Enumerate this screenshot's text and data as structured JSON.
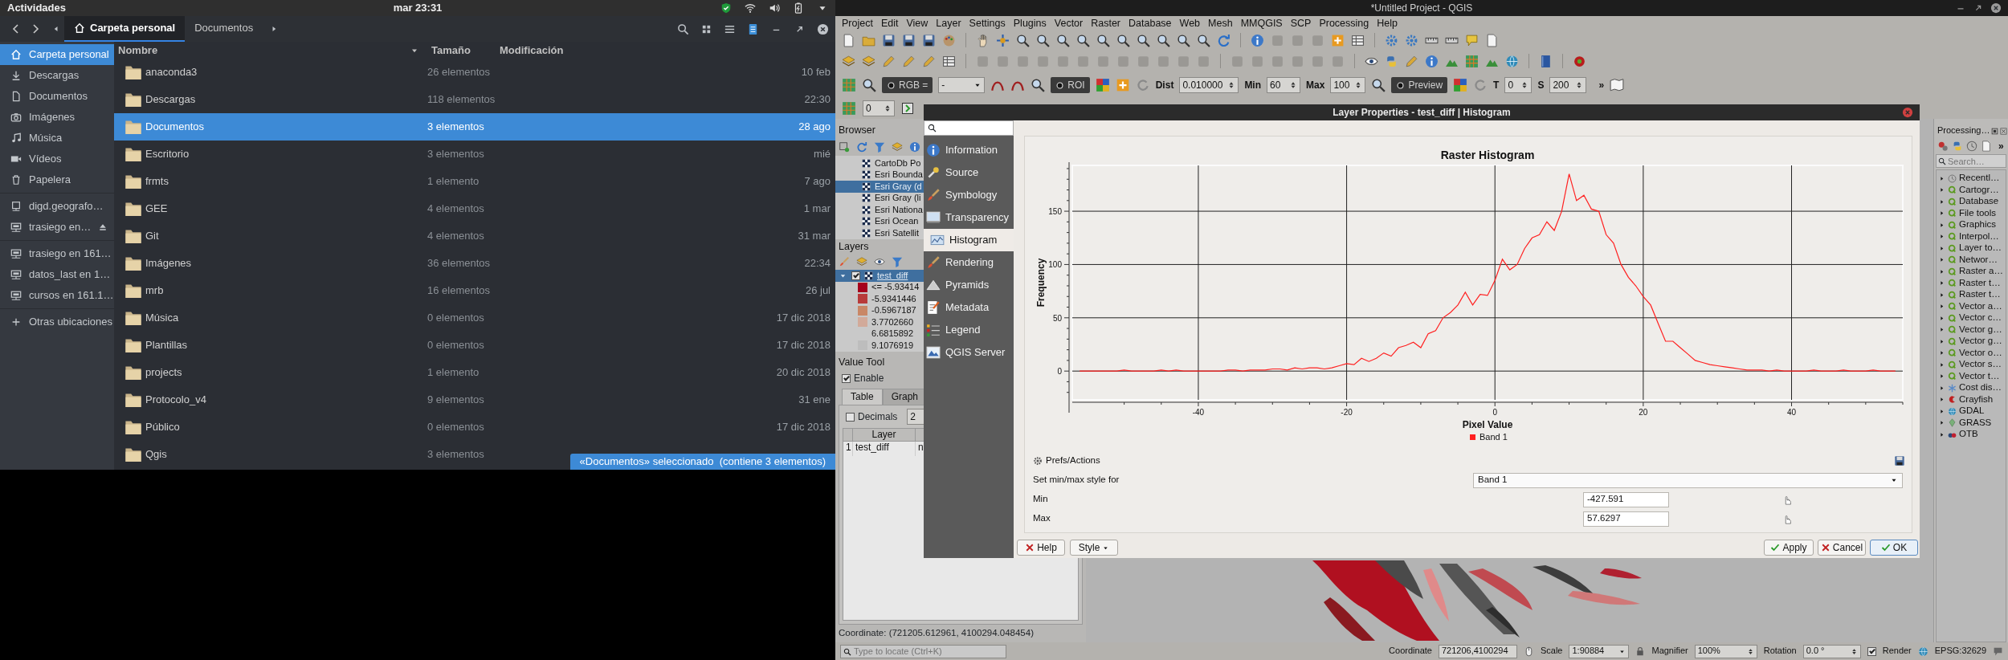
{
  "top_bar": {
    "activities": "Actividades",
    "clock": "mar 23:31"
  },
  "files": {
    "tabs": [
      {
        "label": "Carpeta personal",
        "selected": true
      },
      {
        "label": "Documentos",
        "selected": false
      }
    ],
    "sidebar": [
      [
        {
          "label": "Carpeta personal",
          "selected": true,
          "ejectable": false
        },
        {
          "label": "Descargas",
          "selected": false,
          "ejectable": false
        },
        {
          "label": "Documentos",
          "selected": false,
          "ejectable": false
        },
        {
          "label": "Imágenes",
          "selected": false,
          "ejectable": false
        },
        {
          "label": "Música",
          "selected": false,
          "ejectable": false
        },
        {
          "label": "Vídeos",
          "selected": false,
          "ejectable": false
        },
        {
          "label": "Papelera",
          "selected": false,
          "ejectable": false
        }
      ],
      [
        {
          "label": "digd.geografo…",
          "selected": false,
          "ejectable": false
        },
        {
          "label": "trasiego en…",
          "selected": false,
          "ejectable": true
        }
      ],
      [
        {
          "label": "trasiego en 161…",
          "selected": false,
          "ejectable": false
        },
        {
          "label": "datos_last en 1…",
          "selected": false,
          "ejectable": false
        },
        {
          "label": "cursos en 161.1…",
          "selected": false,
          "ejectable": false
        }
      ],
      [
        {
          "label": "Otras ubicaciones",
          "selected": false,
          "ejectable": false
        }
      ]
    ],
    "columns": [
      {
        "label": "Nombre",
        "sorted": true
      },
      {
        "label": "Tamaño",
        "sorted": false
      },
      {
        "label": "Modificación",
        "sorted": false
      }
    ],
    "rows": [
      {
        "name": "anaconda3",
        "size": "26 elementos",
        "modified": "10 feb",
        "selected": false
      },
      {
        "name": "Descargas",
        "size": "118 elementos",
        "modified": "22:30",
        "selected": false
      },
      {
        "name": "Documentos",
        "size": "3 elementos",
        "modified": "28 ago",
        "selected": true
      },
      {
        "name": "Escritorio",
        "size": "3 elementos",
        "modified": "mié",
        "selected": false
      },
      {
        "name": "frmts",
        "size": "1 elemento",
        "modified": "7 ago",
        "selected": false
      },
      {
        "name": "GEE",
        "size": "4 elementos",
        "modified": "1 mar",
        "selected": false
      },
      {
        "name": "Git",
        "size": "4 elementos",
        "modified": "31 mar",
        "selected": false
      },
      {
        "name": "Imágenes",
        "size": "36 elementos",
        "modified": "22:34",
        "selected": false
      },
      {
        "name": "mrb",
        "size": "16 elementos",
        "modified": "26 jul",
        "selected": false
      },
      {
        "name": "Música",
        "size": "0 elementos",
        "modified": "17 dic 2018",
        "selected": false
      },
      {
        "name": "Plantillas",
        "size": "0 elementos",
        "modified": "17 dic 2018",
        "selected": false
      },
      {
        "name": "projects",
        "size": "1 elemento",
        "modified": "20 dic 2018",
        "selected": false
      },
      {
        "name": "Protocolo_v4",
        "size": "9 elementos",
        "modified": "31 ene",
        "selected": false
      },
      {
        "name": "Público",
        "size": "0 elementos",
        "modified": "17 dic 2018",
        "selected": false
      },
      {
        "name": "Qgis",
        "size": "3 elementos",
        "selected": false
      }
    ],
    "status": "«Documentos» seleccionado  (contiene 3 elementos)"
  },
  "qgis": {
    "title": "*Untitled Project - QGIS",
    "menu": [
      "Project",
      "Edit",
      "View",
      "Layer",
      "Settings",
      "Plugins",
      "Vector",
      "Raster",
      "Database",
      "Web",
      "Mesh",
      "MMQGIS",
      "SCP",
      "Processing",
      "Help"
    ],
    "scp_toolbar": {
      "band_set": "RGB =",
      "band_value": "-",
      "roi": "ROI",
      "dist_label": "Dist",
      "dist": "0.010000",
      "min_label": "Min",
      "min": "60",
      "max_label": "Max",
      "max": "100",
      "preview": "Preview",
      "t_label": "T",
      "t": "0",
      "s_label": "S",
      "s": "200",
      "more": "»"
    },
    "band_spinner": "0",
    "browser": {
      "title": "Browser",
      "items": [
        {
          "label": "CartoDb Po",
          "selected": false
        },
        {
          "label": "Esri Bounda",
          "selected": false
        },
        {
          "label": "Esri Gray (d",
          "selected": true
        },
        {
          "label": "Esri Gray (li",
          "selected": false
        },
        {
          "label": "Esri Nationa",
          "selected": false
        },
        {
          "label": "Esri Ocean",
          "selected": false
        },
        {
          "label": "Esri Satellit",
          "selected": false
        }
      ]
    },
    "layers": {
      "title": "Layers",
      "layer": {
        "label": "test_diff",
        "checked": true,
        "expanded": true,
        "selected": true
      },
      "legend": [
        {
          "label": "<= -5.93414",
          "color": "#a5001c"
        },
        {
          "label": "-5.9341446",
          "color": "#b83a3a"
        },
        {
          "label": "-0.5967187",
          "color": "#c98766"
        },
        {
          "label": "3.7702660",
          "color": "#d2aa9a"
        },
        {
          "label": "6.6815892"
        },
        {
          "label": "9.1076919",
          "color": "#bdbdbd"
        }
      ]
    },
    "value_tool": {
      "title": "Value Tool",
      "enable": {
        "label": "Enable",
        "checked": true
      },
      "tabs": [
        {
          "label": "Table",
          "selected": true
        },
        {
          "label": "Graph",
          "selected": false
        }
      ],
      "decimals": {
        "label": "Decimals",
        "checked": false,
        "value": "2"
      },
      "columns": [
        "Layer"
      ],
      "rows": [
        {
          "index": "1",
          "layer": "test_diff",
          "column_2": "n"
        }
      ]
    },
    "coordinate_readout": "Coordinate: (721205.612961, 4100294.048454)",
    "processing": {
      "title": "Processing…",
      "more": "»",
      "search_placeholder": "Search…",
      "items": [
        "Recentl…",
        "Cartogr…",
        "Database",
        "File tools",
        "Graphics",
        "Interpol…",
        "Layer to…",
        "Networ…",
        "Raster a…",
        "Raster t…",
        "Raster t…",
        "Vector a…",
        "Vector c…",
        "Vector g…",
        "Vector g…",
        "Vector o…",
        "Vector s…",
        "Vector t…",
        "Cost dis…",
        "Crayfish",
        "GDAL",
        "GRASS",
        "OTB"
      ]
    },
    "status_bar": {
      "locate_placeholder": "Type to locate (Ctrl+K)",
      "coordinate_label": "Coordinate",
      "coordinate": "721206,4100294",
      "scale_label": "Scale",
      "scale": "1:90884",
      "magnifier_label": "Magnifier",
      "magnifier": "100%",
      "rotation_label": "Rotation",
      "rotation": "0.0 °",
      "render": {
        "label": "Render",
        "checked": true
      },
      "crs": "EPSG:32629"
    }
  },
  "dialog": {
    "title": "Layer Properties - test_diff | Histogram",
    "nav": [
      {
        "label": "Information",
        "selected": false
      },
      {
        "label": "Source",
        "selected": false
      },
      {
        "label": "Symbology",
        "selected": false
      },
      {
        "label": "Transparency",
        "selected": false
      },
      {
        "label": "Histogram",
        "selected": true
      },
      {
        "label": "Rendering",
        "selected": false
      },
      {
        "label": "Pyramids",
        "selected": false
      },
      {
        "label": "Metadata",
        "selected": false
      },
      {
        "label": "Legend",
        "selected": false
      },
      {
        "label": "QGIS Server",
        "selected": false
      }
    ],
    "chart_data": {
      "type": "line",
      "title": "Raster Histogram",
      "xlabel": "Pixel Value",
      "ylabel": "Frequency",
      "x": [
        -56,
        -55,
        -54,
        -53,
        -52,
        -51,
        -50,
        -49,
        -48,
        -47,
        -46,
        -45,
        -44,
        -43,
        -42,
        -41,
        -40,
        -39,
        -38,
        -37,
        -36,
        -35,
        -34,
        -33,
        -32,
        -31,
        -30,
        -29,
        -28,
        -27,
        -26,
        -25,
        -24,
        -23,
        -22,
        -21,
        -20,
        -19,
        -18,
        -17,
        -16,
        -15,
        -14,
        -13,
        -12,
        -11,
        -10,
        -9,
        -8,
        -7,
        -6,
        -5,
        -4,
        -3,
        -2,
        -1,
        0,
        1,
        2,
        3,
        4,
        5,
        6,
        7,
        8,
        9,
        10,
        11,
        12,
        13,
        14,
        15,
        16,
        17,
        18,
        19,
        20,
        21,
        22,
        23,
        24,
        25,
        26,
        27,
        28,
        29,
        30,
        31,
        32,
        33,
        34,
        35,
        36,
        37,
        38,
        39,
        40,
        41,
        42,
        43,
        44,
        45,
        46,
        47,
        48,
        49,
        50,
        51,
        52,
        53,
        54
      ],
      "series": [
        {
          "name": "Band 1",
          "color": "#ff2020",
          "values": [
            0,
            0,
            0,
            0,
            0,
            0,
            1,
            0,
            0,
            0,
            0,
            1,
            0,
            1,
            0,
            0,
            0,
            0,
            0,
            0,
            1,
            1,
            0,
            1,
            1,
            1,
            2,
            2,
            1,
            3,
            2,
            3,
            3,
            2,
            3,
            5,
            7,
            6,
            12,
            9,
            12,
            17,
            14,
            22,
            24,
            27,
            22,
            35,
            38,
            50,
            55,
            62,
            74,
            62,
            72,
            71,
            85,
            105,
            95,
            100,
            115,
            125,
            128,
            140,
            132,
            150,
            185,
            160,
            165,
            152,
            150,
            128,
            120,
            100,
            88,
            80,
            70,
            62,
            45,
            28,
            28,
            22,
            16,
            10,
            8,
            6,
            5,
            4,
            3,
            2,
            1,
            1,
            1,
            0,
            1,
            0,
            0,
            0,
            0,
            1,
            0,
            0,
            0,
            1,
            0,
            0,
            0,
            1,
            0,
            0,
            0
          ]
        }
      ],
      "xlim": [
        -57,
        55
      ],
      "ylim": [
        -27,
        193
      ],
      "xticks": [
        -40,
        -20,
        0,
        20,
        40
      ],
      "yticks": [
        0,
        50,
        100,
        150
      ],
      "grid": true
    },
    "prefs": "Prefs/Actions",
    "minmax_label": "Set min/max style for",
    "band": "Band 1",
    "min_label": "Min",
    "min": "-427.591",
    "max_label": "Max",
    "max": "57.6297",
    "buttons": {
      "help": "Help",
      "style": "Style",
      "apply": "Apply",
      "cancel": "Cancel",
      "ok": "OK"
    }
  }
}
